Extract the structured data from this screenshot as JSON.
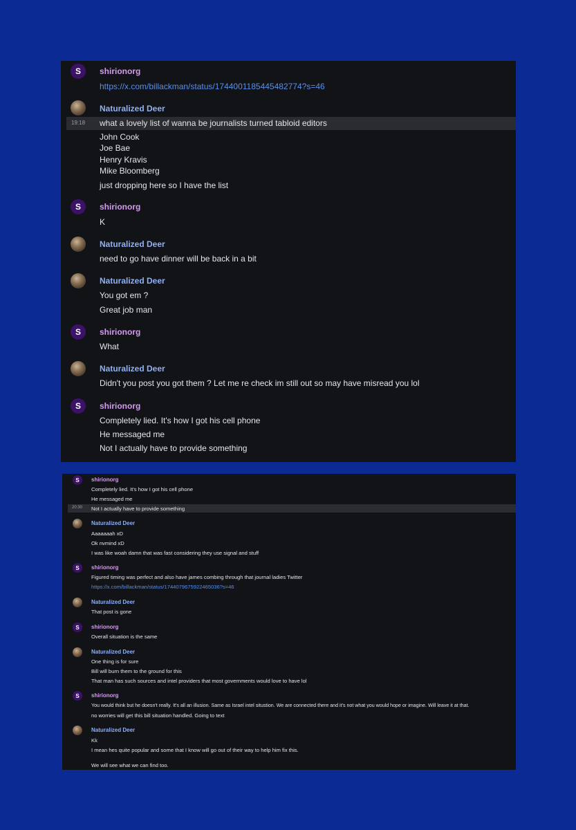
{
  "colors": {
    "background": "#0c2a94",
    "panel": "#111317",
    "shiri_name": "#d59bf0",
    "deer_name": "#8fb0f5",
    "link": "#5a8fe8",
    "text": "#e4e6ea"
  },
  "avatars": {
    "shiri_letter": "S"
  },
  "panel1": {
    "g1": {
      "author": "shirionorg",
      "link": "https://x.com/billackman/status/1744001185445482774?s=46"
    },
    "g2": {
      "author": "Naturalized Deer",
      "timestamp": "19:18",
      "lines": [
        "what a lovely list of wanna be journalists turned tabloid editors",
        "John Cook",
        "Joe Bae",
        "Henry Kravis",
        "Mike Bloomberg",
        "just dropping here so I have the list"
      ]
    },
    "g3": {
      "author": "shirionorg",
      "lines": [
        "K"
      ]
    },
    "g4": {
      "author": "Naturalized Deer",
      "lines": [
        "need to go have dinner will be back in a bit"
      ]
    },
    "g5": {
      "author": "Naturalized Deer",
      "lines": [
        "You got em ?",
        "Great job man"
      ]
    },
    "g6": {
      "author": "shirionorg",
      "lines": [
        "What"
      ]
    },
    "g7": {
      "author": "Naturalized Deer",
      "lines": [
        "Didn't you post you got them ? Let me re check im still out so may have misread you lol"
      ]
    },
    "g8": {
      "author": "shirionorg",
      "lines": [
        "Completely lied. It's how I got his cell phone",
        "He messaged me",
        "Not I actually have to provide something"
      ]
    }
  },
  "panel2": {
    "g1": {
      "author": "shirionorg",
      "timestamp": "20:30",
      "lines": [
        "Completely lied. It's how I got his cell phone",
        "He messaged me",
        "Not I actually have to provide something"
      ]
    },
    "g2": {
      "author": "Naturalized Deer",
      "lines": [
        "Aaaaaaah xD",
        "Ok nvmind xD",
        "I was like woah damn that was fast considering they use signal and stuff"
      ]
    },
    "g3": {
      "author": "shirionorg",
      "lines": [
        "Figured timing was perfect and also have james combing through that journal ladies Twitter"
      ],
      "link": "https://x.com/billackman/status/1744079675922465036?s=46"
    },
    "g4": {
      "author": "Naturalized Deer",
      "lines": [
        "That post is gone"
      ]
    },
    "g5": {
      "author": "shirionorg",
      "lines": [
        "Overall situation is the same"
      ]
    },
    "g6": {
      "author": "Naturalized Deer",
      "lines": [
        "One thing is for sure",
        "Bill will burn them to the ground for this",
        "That man has such sources and intel providers that most governments would love to have lol"
      ]
    },
    "g7": {
      "author": "shirionorg",
      "lines": [
        "You would think but he doesn't really. It's all an illusion. Same as Israel intel situstion. We are connected there and it's not what you would hope or imagine. Will leave it at that.",
        "no worries will get this bill situation handled. Going to text"
      ]
    },
    "g8": {
      "author": "Naturalized Deer",
      "lines": [
        "Kk",
        "I mean hes quite popular and some that I know will go out of their way to help him fix this.",
        "We will see what we can find too."
      ]
    }
  }
}
